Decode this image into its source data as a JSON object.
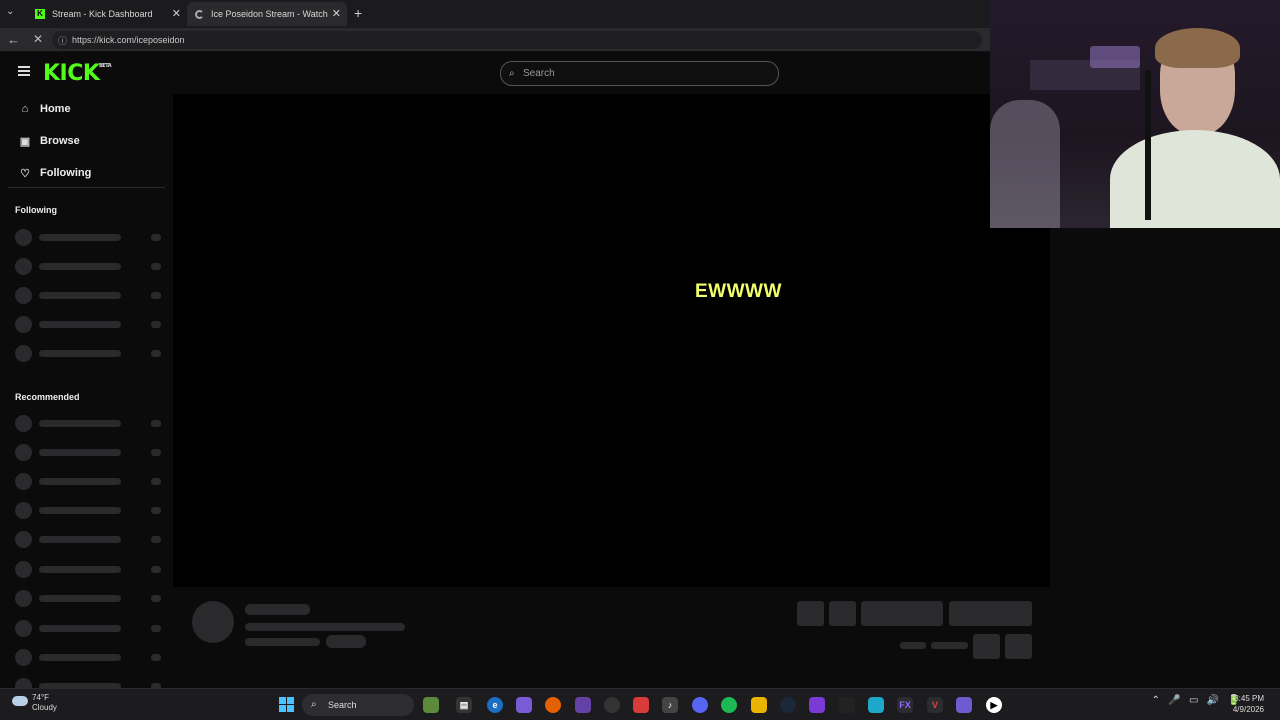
{
  "browser": {
    "tabs": [
      {
        "title": "Stream - Kick Dashboard",
        "close": "✕"
      },
      {
        "title": "Ice Poseidon Stream - Watch Live",
        "close": "✕"
      }
    ],
    "new_tab": "+",
    "url": "https://kick.com/iceposeidon"
  },
  "header": {
    "logo": "KICK",
    "logo_badge": "BETA",
    "search_placeholder": "Search"
  },
  "sidebar": {
    "nav": [
      {
        "label": "Home",
        "icon": "home-icon"
      },
      {
        "label": "Browse",
        "icon": "browse-icon"
      },
      {
        "label": "Following",
        "icon": "heart-icon"
      }
    ],
    "following_heading": "Following",
    "recommended_heading": "Recommended"
  },
  "player": {
    "caption": "EWWWW"
  },
  "taskbar": {
    "weather_temp": "74°F",
    "weather_desc": "Cloudy",
    "search_label": "Search",
    "time": "3:45 PM",
    "date": "4/9/2026"
  },
  "colors": {
    "accent": "#53fc18",
    "background": "#0b0b0c",
    "skeleton": "#2a2a2d",
    "caption": "#f1ff6a"
  }
}
